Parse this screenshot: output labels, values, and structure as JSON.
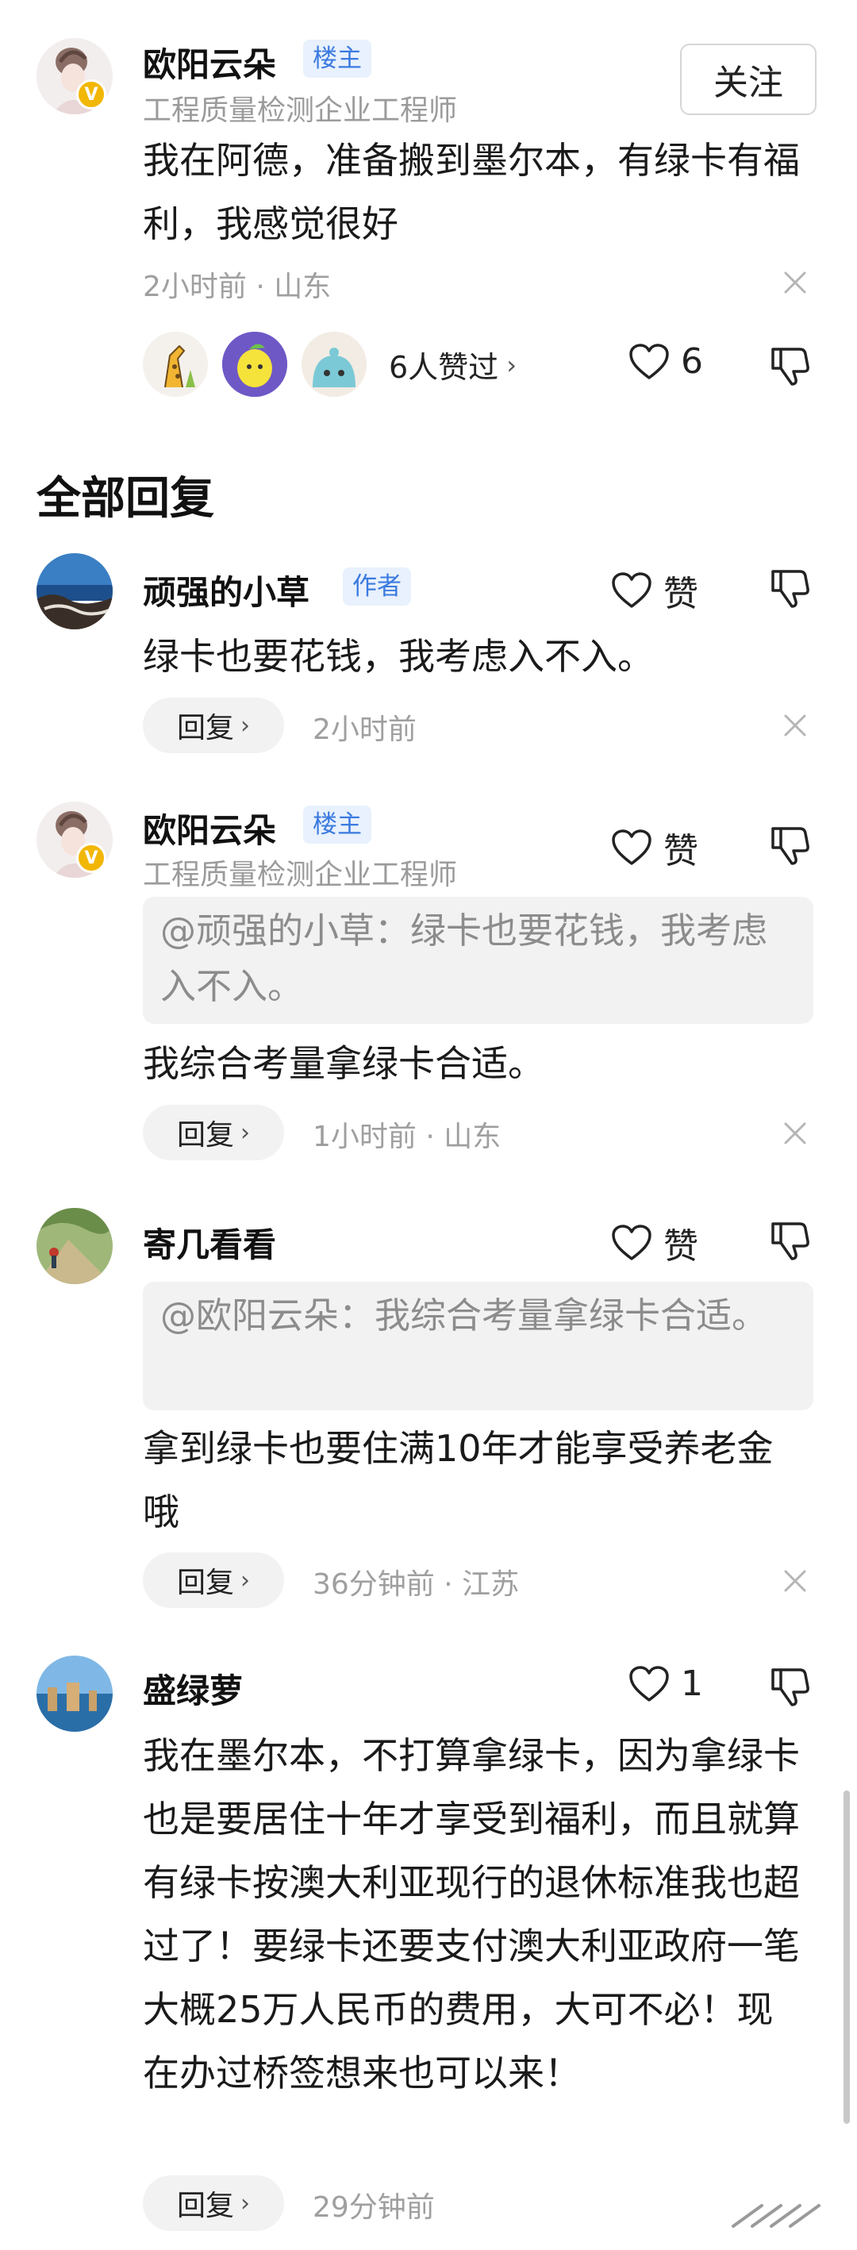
{
  "original_post": {
    "author": "欧阳云朵",
    "badge": "楼主",
    "subtitle": "工程质量检测企业工程师",
    "follow_label": "关注",
    "content": "我在阿德，准备搬到墨尔本，有绿卡有福利，我感觉很好",
    "meta": "2小时前 · 山东",
    "likers_label": "6人赞过",
    "like_count": "6"
  },
  "section_title": "全部回复",
  "replies": [
    {
      "author": "顽强的小草",
      "badge": "作者",
      "like_label": "赞",
      "content": "绿卡也要花钱，我考虑入不入。",
      "reply_label": "回复",
      "time": "2小时前"
    },
    {
      "author": "欧阳云朵",
      "badge": "楼主",
      "subtitle": "工程质量检测企业工程师",
      "like_label": "赞",
      "quote": "@顽强的小草：绿卡也要花钱，我考虑入不入。",
      "content": "我综合考量拿绿卡合适。",
      "reply_label": "回复",
      "time": "1小时前 · 山东"
    },
    {
      "author": "寄几看看",
      "like_label": "赞",
      "quote": "@欧阳云朵：我综合考量拿绿卡合适。",
      "content": "拿到绿卡也要住满10年才能享受养老金哦",
      "reply_label": "回复",
      "time": "36分钟前 · 江苏"
    },
    {
      "author": "盛绿萝",
      "like_label": "1",
      "content": "我在墨尔本，不打算拿绿卡，因为拿绿卡也是要居住十年才享受到福利，而且就算有绿卡按澳大利亚现行的退休标准我也超过了！要绿卡还要支付澳大利亚政府一笔大概25万人民币的费用，大可不必！现在办过桥签想来也可以来！",
      "reply_label": "回复",
      "time": "29分钟前"
    }
  ],
  "colors": {
    "badge_text": "#3b7ae0",
    "badge_bg": "#e8f1fd",
    "verified": "#f2b705",
    "muted": "#9f9f9f",
    "quote_bg": "#f2f2f3"
  },
  "icons": [
    "verified-v-icon",
    "heart-icon",
    "dislike-thumb-icon",
    "close-icon",
    "chevron-right-icon"
  ]
}
